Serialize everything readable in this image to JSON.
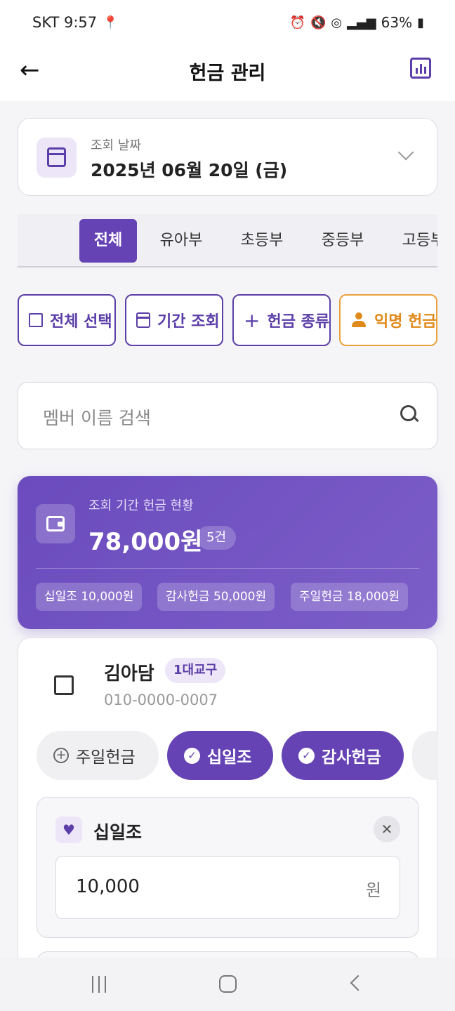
{
  "status_bar": {
    "carrier_time": "SKT 9:57",
    "battery": "63%"
  },
  "app_bar": {
    "title": "헌금 관리"
  },
  "date_picker": {
    "label": "조회 날짜",
    "value": "2025년 06월 20일 (금)"
  },
  "tabs": [
    {
      "label": "전체",
      "active": true
    },
    {
      "label": "유아부",
      "active": false
    },
    {
      "label": "초등부",
      "active": false
    },
    {
      "label": "중등부",
      "active": false
    },
    {
      "label": "고등부",
      "active": false
    }
  ],
  "actions": {
    "select_all": "전체 선택",
    "period": "기간 조회",
    "offering_type": "헌금 종류",
    "anonymous": "익명 헌금"
  },
  "search": {
    "placeholder": "멤버 이름 검색"
  },
  "summary": {
    "label": "조회 기간 헌금 현황",
    "amount": "78,000원",
    "count": "5건",
    "chips": [
      "십일조 10,000원",
      "감사헌금 50,000원",
      "주일헌금 18,000원"
    ]
  },
  "member": {
    "name": "김아담",
    "badge": "1대교구",
    "phone": "010-0000-0007",
    "pills": [
      {
        "label": "주일헌금",
        "selected": false
      },
      {
        "label": "십일조",
        "selected": true
      },
      {
        "label": "감사헌금",
        "selected": true
      }
    ],
    "entry": {
      "title": "십일조",
      "value": "10,000",
      "unit": "원"
    }
  },
  "colors": {
    "primary": "#6643b5",
    "accent_orange": "#e08a1c",
    "background": "#f5f5f8"
  }
}
